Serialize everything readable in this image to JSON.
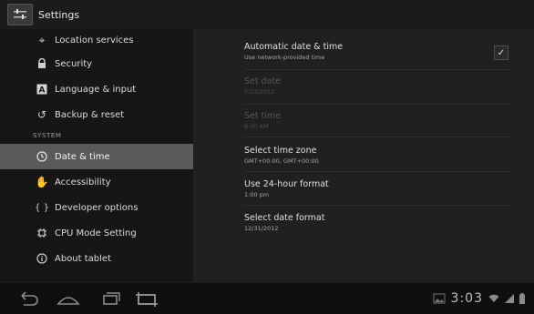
{
  "window": {
    "title": "Settings"
  },
  "sidebar": {
    "items": [
      {
        "label": "Location services",
        "icon": "location-icon"
      },
      {
        "label": "Security",
        "icon": "lock-icon"
      },
      {
        "label": "Language & input",
        "icon": "language-icon"
      },
      {
        "label": "Backup & reset",
        "icon": "backup-icon"
      }
    ],
    "section": "SYSTEM",
    "system_items": [
      {
        "label": "Date & time",
        "icon": "clock-icon",
        "selected": true
      },
      {
        "label": "Accessibility",
        "icon": "hand-icon"
      },
      {
        "label": "Developer options",
        "icon": "braces-icon"
      },
      {
        "label": "CPU Mode Setting",
        "icon": "chip-icon"
      },
      {
        "label": "About tablet",
        "icon": "info-icon"
      }
    ]
  },
  "main": {
    "rows": [
      {
        "title": "Automatic date & time",
        "subtitle": "Use network-provided time",
        "checked": true
      },
      {
        "title": "Set date",
        "subtitle": "7/23/2012",
        "disabled": true
      },
      {
        "title": "Set time",
        "subtitle": "9:00 AM",
        "disabled": true
      },
      {
        "title": "Select time zone",
        "subtitle": "GMT+00:00, GMT+00:00"
      },
      {
        "title": "Use 24-hour format",
        "subtitle": "1:00 pm"
      },
      {
        "title": "Select date format",
        "subtitle": "12/31/2012"
      }
    ]
  },
  "statusbar": {
    "time": "3:03"
  }
}
